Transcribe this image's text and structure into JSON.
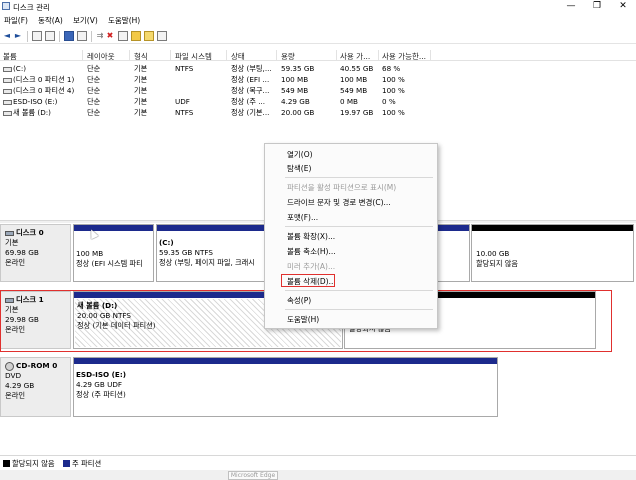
{
  "window": {
    "title": "디스크 관리",
    "minimize": "—",
    "maximize": "❐",
    "close": "✕"
  },
  "menu": {
    "file": "파일(F)",
    "action": "동작(A)",
    "view": "보기(V)",
    "help": "도움말(H)"
  },
  "toolbar": {
    "back": "◄",
    "forward": "►",
    "delete": "✖"
  },
  "volume_table": {
    "headers": [
      "볼륨",
      "레이아웃",
      "형식",
      "파일 시스템",
      "상태",
      "용량",
      "사용 가...",
      "사용 가능한..."
    ],
    "rows": [
      {
        "volume": "(C:)",
        "layout": "단순",
        "type": "기본",
        "fs": "NTFS",
        "status": "정상 (부팅,...",
        "capacity": "59.35 GB",
        "free": "40.55 GB",
        "pct": "68 %"
      },
      {
        "volume": "(디스크 0 파티션 1)",
        "layout": "단순",
        "type": "기본",
        "fs": "",
        "status": "정상 (EFI ...",
        "capacity": "100 MB",
        "free": "100 MB",
        "pct": "100 %"
      },
      {
        "volume": "(디스크 0 파티션 4)",
        "layout": "단순",
        "type": "기본",
        "fs": "",
        "status": "정상 (복구...",
        "capacity": "549 MB",
        "free": "549 MB",
        "pct": "100 %"
      },
      {
        "volume": "ESD-ISO (E:)",
        "layout": "단순",
        "type": "기본",
        "fs": "UDF",
        "status": "정상 (주 ...",
        "capacity": "4.29 GB",
        "free": "0 MB",
        "pct": "0 %"
      },
      {
        "volume": "새 볼륨 (D:)",
        "layout": "단순",
        "type": "기본",
        "fs": "NTFS",
        "status": "정상 (기본...",
        "capacity": "20.00 GB",
        "free": "19.97 GB",
        "pct": "100 %"
      }
    ]
  },
  "disks": {
    "disk0": {
      "name": "디스크 0",
      "kind": "기본",
      "size": "69.98 GB",
      "state": "온라인",
      "p1": {
        "size": "100 MB",
        "status": "정상 (EFI 시스템 파티"
      },
      "p2": {
        "title": "(C:)",
        "size": "59.35 GB NTFS",
        "status": "정상 (부팅, 페이지 파일, 크래시"
      },
      "p3": {
        "size": "10.00 GB",
        "status": "할당되지 않음"
      }
    },
    "disk1": {
      "name": "디스크 1",
      "kind": "기본",
      "size": "29.98 GB",
      "state": "온라인",
      "p1": {
        "title": "새 볼륨  (D:)",
        "size": "20.00 GB NTFS",
        "status": "정상 (기본 데이터 파티션)"
      },
      "p2": {
        "status": "할당되지 않음"
      }
    },
    "cdrom0": {
      "name": "CD-ROM 0",
      "kind": "DVD",
      "size": "4.29 GB",
      "state": "온라인",
      "p1": {
        "title": "ESD-ISO  (E:)",
        "size": "4.29 GB UDF",
        "status": "정상 (주 파티션)"
      }
    }
  },
  "context_menu": {
    "open": "열기(O)",
    "explore": "탐색(E)",
    "mark_active": "파티션을 활성 파티션으로 표시(M)",
    "change_letter": "드라이브 문자 및 경로 변경(C)...",
    "format": "포맷(F)...",
    "extend": "볼륨 확장(X)...",
    "shrink": "볼륨 축소(H)...",
    "add_mirror": "미러 추가(A)...",
    "delete_volume": "볼륨 삭제(D)...",
    "properties": "속성(P)",
    "help": "도움말(H)"
  },
  "legend": {
    "unallocated": "할당되지 않음",
    "primary": "주 파티션"
  },
  "taskbar_hint": "Microsoft Edge",
  "colors": {
    "primary_partition": "#1c2a8c",
    "unallocated": "#000000",
    "highlight_border": "#e0302e"
  }
}
